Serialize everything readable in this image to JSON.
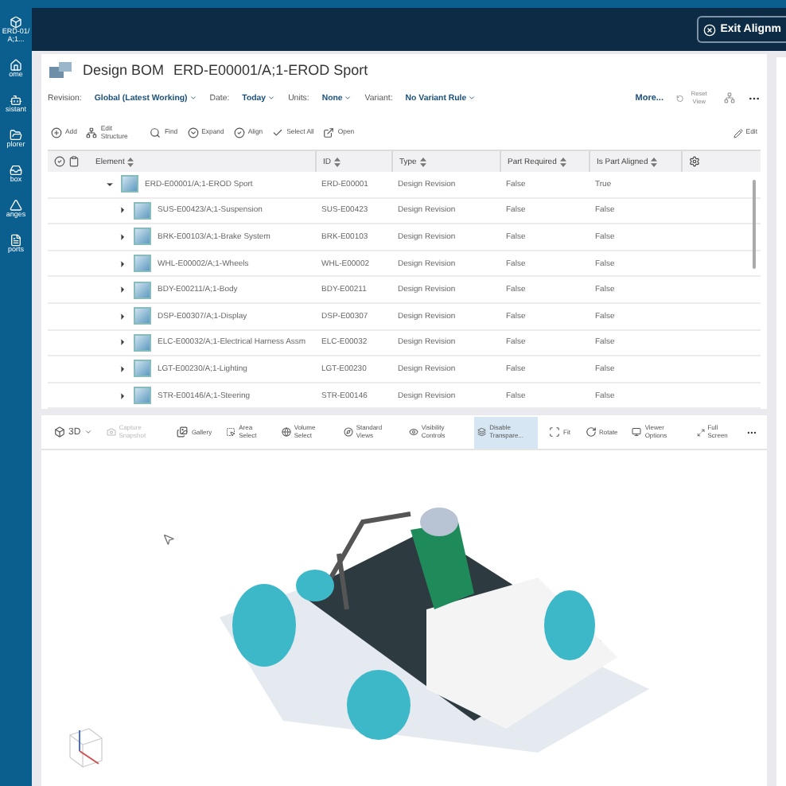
{
  "sidebar": {
    "items": [
      {
        "label": "ERD-01/A;1..."
      },
      {
        "label": "ome"
      },
      {
        "label": "sistant"
      },
      {
        "label": "plorer"
      },
      {
        "label": "box"
      },
      {
        "label": "anges"
      },
      {
        "label": "ports"
      }
    ]
  },
  "header": {
    "exit_button": "Exit Alignm"
  },
  "bom": {
    "title": "Design BOM",
    "object": "ERD-E00001/A;1-EROD Sport",
    "filters": [
      {
        "label": "Revision:",
        "value": "Global (Latest Working)"
      },
      {
        "label": "Date:",
        "value": "Today"
      },
      {
        "label": "Units:",
        "value": "None"
      },
      {
        "label": "Variant:",
        "value": "No Variant Rule"
      }
    ],
    "more": "More...",
    "reset_view": "Reset View",
    "toolbar": [
      "Add",
      "Edit Structure",
      "Find",
      "Expand",
      "Align",
      "Select All",
      "Open"
    ],
    "edit": "Edit",
    "table": {
      "columns": [
        "Element",
        "ID",
        "Type",
        "Part Required",
        "Is Part Aligned"
      ],
      "rows": [
        {
          "element": "ERD-E00001/A;1-EROD Sport",
          "id": "ERD-E00001",
          "type": "Design Revision",
          "part_required": "False",
          "aligned": "True",
          "expanded": true,
          "children": [
            {
              "element": "SUS-E00423/A;1-Suspension",
              "id": "SUS-E00423",
              "type": "Design Revision",
              "part_required": "False",
              "aligned": "False",
              "expanded": false
            },
            {
              "element": "BRK-E00103/A;1-Brake System",
              "id": "BRK-E00103",
              "type": "Design Revision",
              "part_required": "False",
              "aligned": "False",
              "expanded": false
            },
            {
              "element": "WHL-E00002/A;1-Wheels",
              "id": "WHL-E00002",
              "type": "Design Revision",
              "part_required": "False",
              "aligned": "False",
              "expanded": false
            },
            {
              "element": "BDY-E00211/A;1-Body",
              "id": "BDY-E00211",
              "type": "Design Revision",
              "part_required": "False",
              "aligned": "False",
              "expanded": false
            },
            {
              "element": "DSP-E00307/A;1-Display",
              "id": "DSP-E00307",
              "type": "Design Revision",
              "part_required": "False",
              "aligned": "False",
              "expanded": false
            },
            {
              "element": "ELC-E00032/A;1-Electrical Harness Assm",
              "id": "ELC-E00032",
              "type": "Design Revision",
              "part_required": "False",
              "aligned": "False",
              "expanded": false
            },
            {
              "element": "LGT-E00230/A;1-Lighting",
              "id": "LGT-E00230",
              "type": "Design Revision",
              "part_required": "False",
              "aligned": "False",
              "expanded": false
            },
            {
              "element": "STR-E00146/A;1-Steering",
              "id": "STR-E00146",
              "type": "Design Revision",
              "part_required": "False",
              "aligned": "False",
              "expanded": false
            }
          ]
        }
      ]
    }
  },
  "viewer": {
    "mode": "3D",
    "toolbar": [
      {
        "label": "Capture Snapshot",
        "disabled": true,
        "selected": false
      },
      {
        "label": "Gallery",
        "disabled": false,
        "selected": false
      },
      {
        "label": "Area Select",
        "disabled": false,
        "selected": false
      },
      {
        "label": "Volume Select",
        "disabled": false,
        "selected": false
      },
      {
        "label": "Standard Views",
        "disabled": false,
        "selected": false
      },
      {
        "label": "Visibility Controls",
        "disabled": false,
        "selected": false
      },
      {
        "label": "Disable Transpare...",
        "disabled": false,
        "selected": true
      },
      {
        "label": "Fit",
        "disabled": false,
        "selected": false
      },
      {
        "label": "Rotate",
        "disabled": false,
        "selected": false
      },
      {
        "label": "Viewer Options",
        "disabled": false,
        "selected": false
      }
    ],
    "full_screen": "Full Screen"
  }
}
